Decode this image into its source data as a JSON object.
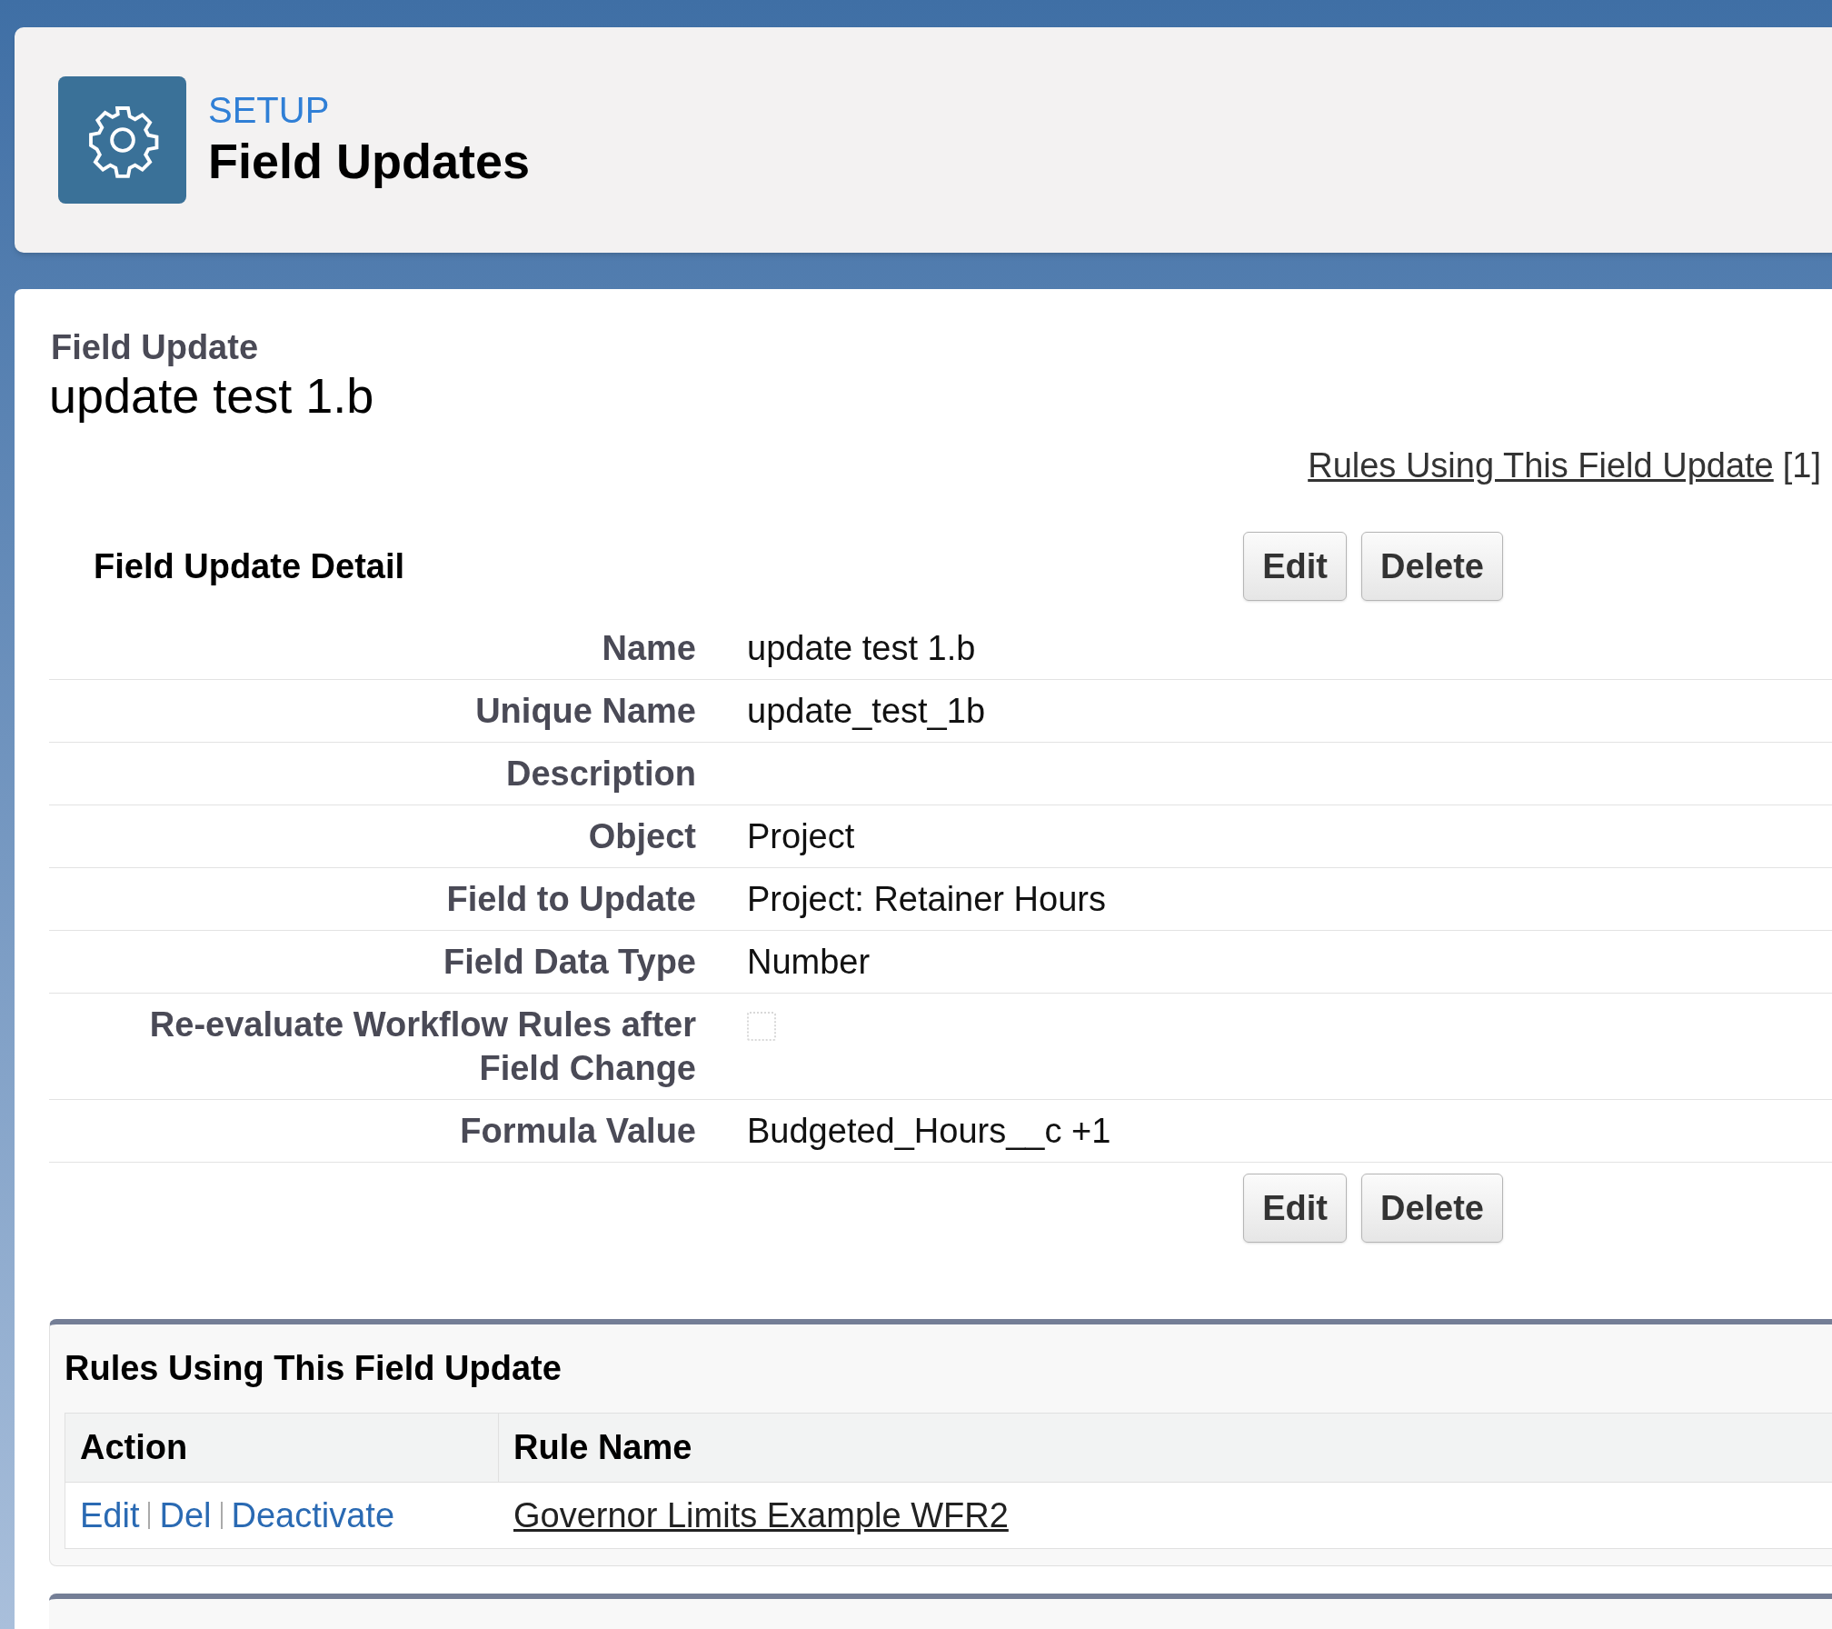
{
  "header": {
    "eyebrow": "SETUP",
    "title": "Field Updates"
  },
  "record": {
    "type_label": "Field Update",
    "name": "update test 1.b"
  },
  "related_link": {
    "label": "Rules Using This Field Update",
    "count": "[1]"
  },
  "detail": {
    "title": "Field Update Detail",
    "buttons": [
      "Edit",
      "Delete"
    ],
    "fields": [
      {
        "label": "Name",
        "value": "update test 1.b",
        "kind": "text"
      },
      {
        "label": "Unique Name",
        "value": "update_test_1b",
        "kind": "text"
      },
      {
        "label": "Description",
        "kind": "text"
      },
      {
        "label": "Object",
        "value": "Project",
        "kind": "text"
      },
      {
        "label": "Field to Update",
        "value": "Project: Retainer Hours",
        "kind": "text"
      },
      {
        "label": "Field Data Type",
        "value": "Number",
        "kind": "text"
      },
      {
        "label": "Re-evaluate Workflow Rules after Field Change",
        "checked": false,
        "kind": "checkbox"
      },
      {
        "label": "Formula Value",
        "value": "Budgeted_Hours__c +1",
        "kind": "text"
      }
    ],
    "bottom_buttons": [
      "Edit",
      "Delete"
    ]
  },
  "rules": {
    "title": "Rules Using This Field Update",
    "columns": [
      "Action",
      "Rule Name"
    ],
    "rows": [
      {
        "actions": [
          "Edit",
          "Del",
          "Deactivate"
        ],
        "rule_name": "Governor Limits Example WFR2"
      }
    ]
  }
}
